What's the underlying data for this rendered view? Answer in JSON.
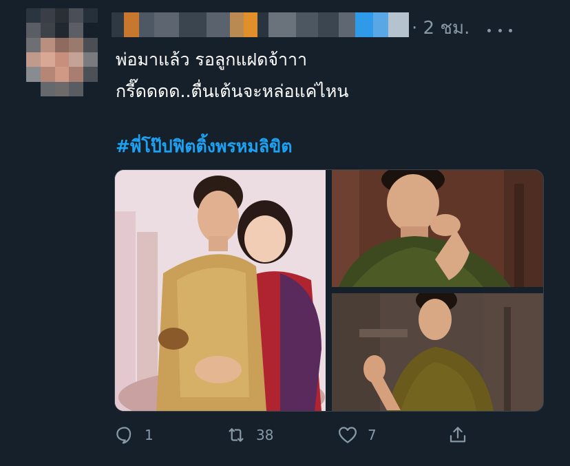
{
  "tweet": {
    "time": "· 2 ชม.",
    "text_lines": [
      "พ่อมาแล้ว รอลูกแฝดจ้าาา",
      "กรี๊ดดดด..ตื่นเต้นจะหล่อแค่ไหน"
    ],
    "hashtag": "#พี่โป๊ปฟิตติ้งพรหมลิขิต",
    "media": [
      {
        "description": "Couple in traditional Thai costume"
      },
      {
        "description": "Man in green silk shirt, hand at chin"
      },
      {
        "description": "Man in brown silk shirt making finger heart"
      }
    ],
    "actions": {
      "reply_count": "1",
      "retweet_count": "38",
      "like_count": "7"
    }
  },
  "icons": [
    "more-icon",
    "reply-icon",
    "retweet-icon",
    "like-icon",
    "share-icon"
  ],
  "colors": {
    "background": "#15202b",
    "text": "#ffffff",
    "secondary": "#8899a6",
    "link": "#1da1f2",
    "border": "#38444d"
  }
}
